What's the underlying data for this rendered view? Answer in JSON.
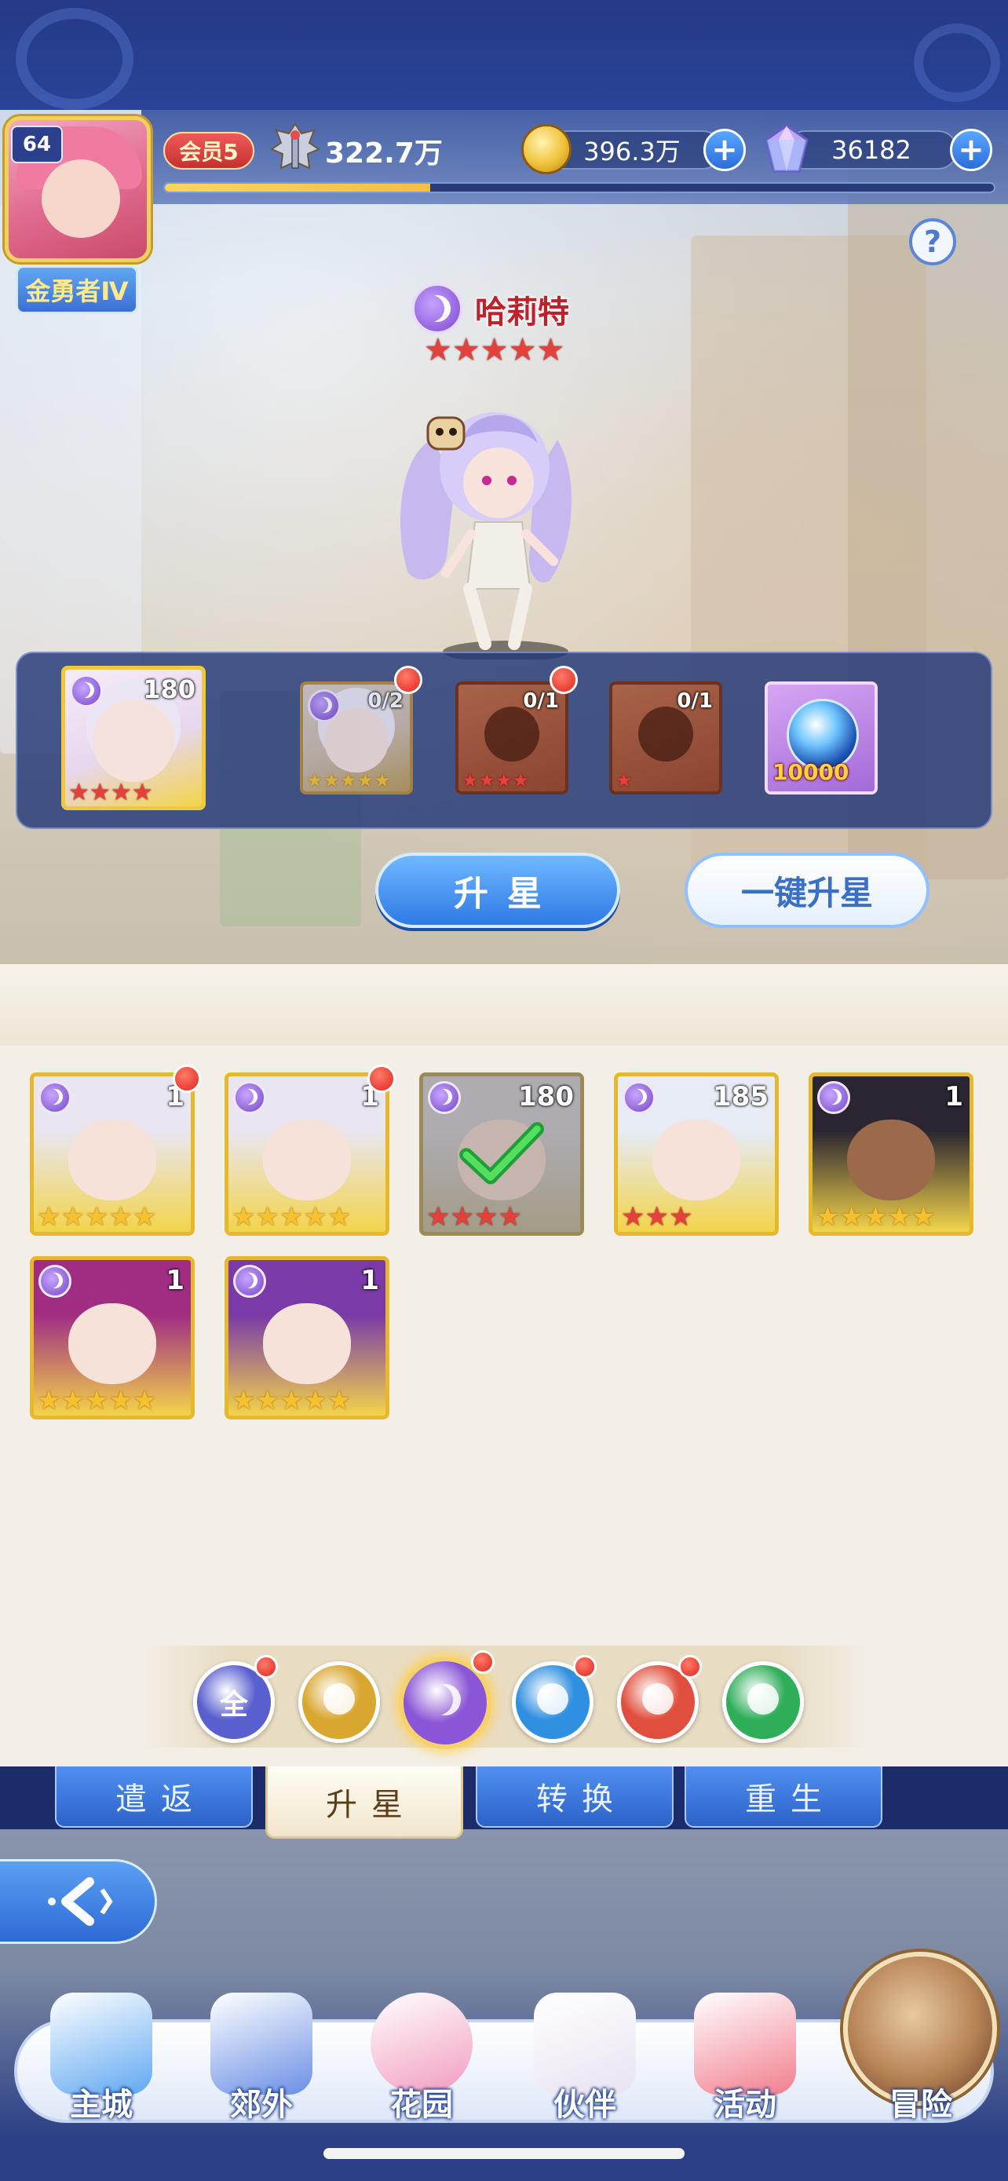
{
  "header": {
    "player_level": "64",
    "player_rank": "金勇者Ⅳ",
    "vip_label": "会员5",
    "power": "322.7万",
    "xp_progress_fraction": 0.32,
    "gold": "396.3万",
    "gems": "36182",
    "help_label": "?"
  },
  "hero": {
    "name": "哈莉特",
    "element_icon": "moon-icon",
    "stars": 5,
    "star_color": "red"
  },
  "upgrade_materials": [
    {
      "type": "hero",
      "count": "180",
      "stars": 4,
      "star_color": "red"
    },
    {
      "type": "hero",
      "count": "0/2",
      "stars": 5,
      "star_color": "gold",
      "red_dot": true
    },
    {
      "type": "silhouette",
      "count": "0/1",
      "stars": 4,
      "star_color": "red",
      "red_dot": true
    },
    {
      "type": "silhouette",
      "count": "0/1",
      "stars": 1,
      "star_color": "red"
    },
    {
      "type": "orb",
      "count": "10000"
    }
  ],
  "buttons": {
    "star_up": "升星",
    "one_key_star_up": "一键升星"
  },
  "hero_list": [
    {
      "count": "1",
      "stars": 5,
      "star_color": "gold",
      "red_dot": true,
      "bg": "#f3d44a",
      "hair": "#e9e6f2"
    },
    {
      "count": "1",
      "stars": 5,
      "star_color": "gold",
      "red_dot": true,
      "bg": "#f3d44a",
      "hair": "#e9e6f2"
    },
    {
      "count": "180",
      "stars": 4,
      "star_color": "red",
      "selected": true,
      "bg": "#c9b884",
      "hair": "#cfc9d6"
    },
    {
      "count": "185",
      "stars": 3,
      "star_color": "red",
      "bg": "#f3d44a",
      "hair": "#e6ebf6"
    },
    {
      "count": "1",
      "stars": 5,
      "star_color": "gold",
      "bg": "#f3d44a",
      "hair": "#2a2530"
    },
    {
      "count": "1",
      "stars": 5,
      "star_color": "gold",
      "bg": "#f3d44a",
      "hair": "#a02d82"
    },
    {
      "count": "1",
      "stars": 5,
      "star_color": "gold",
      "bg": "#f3d44a",
      "hair": "#7a3aa8"
    }
  ],
  "element_filters": [
    {
      "name": "all",
      "label": "全",
      "color": "#5a5fd0",
      "red_dot": true
    },
    {
      "name": "light",
      "label": "",
      "color": "#d9a630",
      "red_dot": false
    },
    {
      "name": "moon",
      "label": "",
      "color": "#8a55d6",
      "red_dot": true,
      "selected": true
    },
    {
      "name": "water",
      "label": "",
      "color": "#2f8fe0",
      "red_dot": true
    },
    {
      "name": "fire",
      "label": "",
      "color": "#e04f3d",
      "red_dot": true
    },
    {
      "name": "wind",
      "label": "",
      "color": "#2fae5a",
      "red_dot": false
    }
  ],
  "function_tabs": [
    "遣返",
    "升星",
    "转换",
    "重生"
  ],
  "active_tab": "升星",
  "nav": [
    {
      "label": "主城",
      "icon": "castle-icon"
    },
    {
      "label": "郊外",
      "icon": "magic-circle-icon"
    },
    {
      "label": "花园",
      "icon": "heart-icon"
    },
    {
      "label": "伙伴",
      "icon": "partner-icon"
    },
    {
      "label": "活动",
      "icon": "gift-icon"
    },
    {
      "label": "冒险",
      "icon": "adventure-icon"
    }
  ]
}
